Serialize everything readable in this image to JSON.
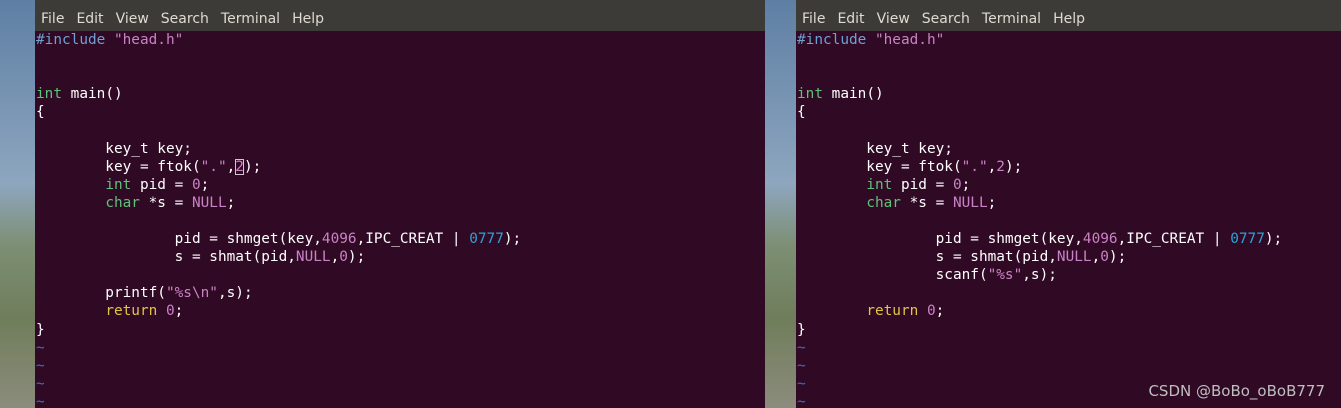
{
  "menu": [
    "File",
    "Edit",
    "View",
    "Search",
    "Terminal",
    "Help"
  ],
  "left_code": [
    [
      {
        "t": "#include ",
        "c": "pre"
      },
      {
        "t": "\"head.h\"",
        "c": "str"
      }
    ],
    [],
    [],
    [
      {
        "t": "int",
        "c": "type"
      },
      {
        "t": " main()"
      }
    ],
    [
      {
        "t": "{"
      }
    ],
    [],
    [
      {
        "t": "        key_t key;"
      }
    ],
    [
      {
        "t": "        key = ftok("
      },
      {
        "t": "\".\"",
        "c": "str"
      },
      {
        "t": ","
      },
      {
        "t": "2",
        "c": "num",
        "cursor": true
      },
      {
        "t": ");"
      }
    ],
    [
      {
        "t": "        "
      },
      {
        "t": "int",
        "c": "type"
      },
      {
        "t": " pid = "
      },
      {
        "t": "0",
        "c": "num"
      },
      {
        "t": ";"
      }
    ],
    [
      {
        "t": "        "
      },
      {
        "t": "char",
        "c": "type"
      },
      {
        "t": " *s = "
      },
      {
        "t": "NULL",
        "c": "null"
      },
      {
        "t": ";"
      }
    ],
    [],
    [
      {
        "t": "                pid = shmget(key,"
      },
      {
        "t": "4096",
        "c": "num"
      },
      {
        "t": ",IPC_CREAT | "
      },
      {
        "t": "0777",
        "c": "num2"
      },
      {
        "t": ");"
      }
    ],
    [
      {
        "t": "                s = shmat(pid,"
      },
      {
        "t": "NULL",
        "c": "null"
      },
      {
        "t": ","
      },
      {
        "t": "0",
        "c": "num"
      },
      {
        "t": ");"
      }
    ],
    [],
    [
      {
        "t": "        printf("
      },
      {
        "t": "\"%s\\n\"",
        "c": "str"
      },
      {
        "t": ",s);"
      }
    ],
    [
      {
        "t": "        "
      },
      {
        "t": "return",
        "c": "kw"
      },
      {
        "t": " "
      },
      {
        "t": "0",
        "c": "num"
      },
      {
        "t": ";"
      }
    ],
    [
      {
        "t": "}"
      }
    ],
    [
      {
        "t": "~",
        "c": "tilde"
      }
    ],
    [
      {
        "t": "~",
        "c": "tilde"
      }
    ],
    [
      {
        "t": "~",
        "c": "tilde"
      }
    ],
    [
      {
        "t": "~",
        "c": "tilde"
      }
    ]
  ],
  "right_code": [
    [
      {
        "t": "#include ",
        "c": "pre"
      },
      {
        "t": "\"head.h\"",
        "c": "str"
      }
    ],
    [],
    [],
    [
      {
        "t": "int",
        "c": "type"
      },
      {
        "t": " main()"
      }
    ],
    [
      {
        "t": "{"
      }
    ],
    [],
    [
      {
        "t": "        key_t key;"
      }
    ],
    [
      {
        "t": "        key = ftok("
      },
      {
        "t": "\".\"",
        "c": "str"
      },
      {
        "t": ","
      },
      {
        "t": "2",
        "c": "num"
      },
      {
        "t": ");"
      }
    ],
    [
      {
        "t": "        "
      },
      {
        "t": "int",
        "c": "type"
      },
      {
        "t": " pid = "
      },
      {
        "t": "0",
        "c": "num"
      },
      {
        "t": ";"
      }
    ],
    [
      {
        "t": "        "
      },
      {
        "t": "char",
        "c": "type"
      },
      {
        "t": " *s = "
      },
      {
        "t": "NULL",
        "c": "null"
      },
      {
        "t": ";"
      }
    ],
    [],
    [
      {
        "t": "                pid = shmget(key,"
      },
      {
        "t": "4096",
        "c": "num"
      },
      {
        "t": ",IPC_CREAT | "
      },
      {
        "t": "0777",
        "c": "num2"
      },
      {
        "t": ");"
      }
    ],
    [
      {
        "t": "                s = shmat(pid,"
      },
      {
        "t": "NULL",
        "c": "null"
      },
      {
        "t": ","
      },
      {
        "t": "0",
        "c": "num"
      },
      {
        "t": ");"
      }
    ],
    [
      {
        "t": "                scanf("
      },
      {
        "t": "\"%s\"",
        "c": "str"
      },
      {
        "t": ",s);"
      }
    ],
    [],
    [
      {
        "t": "        "
      },
      {
        "t": "return",
        "c": "kw"
      },
      {
        "t": " "
      },
      {
        "t": "0",
        "c": "num"
      },
      {
        "t": ";"
      }
    ],
    [
      {
        "t": "}"
      }
    ],
    [
      {
        "t": "~",
        "c": "tilde"
      }
    ],
    [
      {
        "t": "~",
        "c": "tilde"
      }
    ],
    [
      {
        "t": "~",
        "c": "tilde"
      }
    ],
    [
      {
        "t": "~",
        "c": "tilde"
      }
    ]
  ],
  "watermark": "CSDN @BoBo_oBoB777",
  "colors": {
    "terminal_bg": "#300a24",
    "menubar_bg": "#3c3b37",
    "preprocessor": "#6f9fd3",
    "string": "#c982c5",
    "type": "#5ec27a",
    "keyword": "#e0c545",
    "octal": "#2aa3d8",
    "tilde": "#3b6ec8"
  }
}
